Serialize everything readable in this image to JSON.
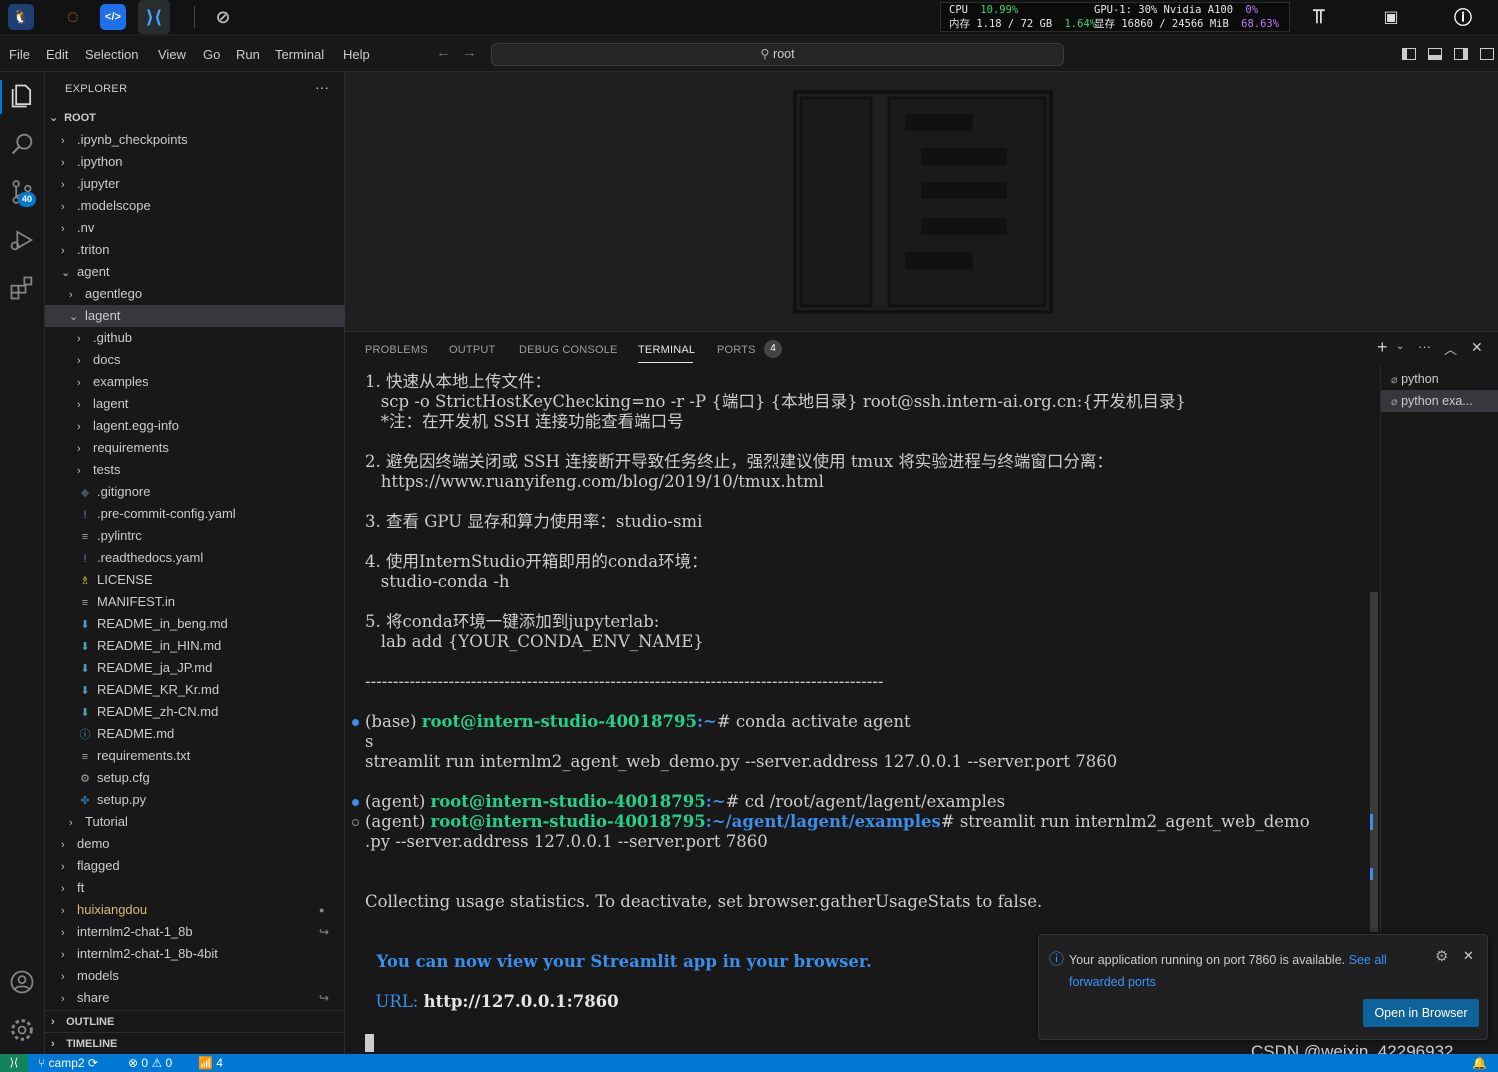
{
  "top_bar": {
    "stats": {
      "cpu_label": "CPU",
      "cpu_value": "10.99%",
      "gpu_label": "GPU-1: 30% Nvidia A100",
      "gpu_value": "0%",
      "mem_label": "内存 1.18 / 72 GB",
      "mem_value": "1.64%",
      "vram_label": "显存 16860 / 24566 MiB",
      "vram_value": "68.63%"
    }
  },
  "menu": {
    "items": [
      "File",
      "Edit",
      "Selection",
      "View",
      "Go",
      "Run",
      "Terminal",
      "Help"
    ],
    "search_text": "root"
  },
  "activity": {
    "scm_badge": "40"
  },
  "sidebar": {
    "title": "EXPLORER",
    "root_label": "ROOT",
    "tree": [
      {
        "label": ".ipynb_checkpoints",
        "depth": 1,
        "kind": "folder",
        "open": false
      },
      {
        "label": ".ipython",
        "depth": 1,
        "kind": "folder",
        "open": false
      },
      {
        "label": ".jupyter",
        "depth": 1,
        "kind": "folder",
        "open": false
      },
      {
        "label": ".modelscope",
        "depth": 1,
        "kind": "folder",
        "open": false
      },
      {
        "label": ".nv",
        "depth": 1,
        "kind": "folder",
        "open": false
      },
      {
        "label": ".triton",
        "depth": 1,
        "kind": "folder",
        "open": false
      },
      {
        "label": "agent",
        "depth": 1,
        "kind": "folder",
        "open": true
      },
      {
        "label": "agentlego",
        "depth": 2,
        "kind": "folder",
        "open": false
      },
      {
        "label": "lagent",
        "depth": 2,
        "kind": "folder",
        "open": true,
        "selected": true
      },
      {
        "label": ".github",
        "depth": 3,
        "kind": "folder",
        "open": false
      },
      {
        "label": "docs",
        "depth": 3,
        "kind": "folder",
        "open": false
      },
      {
        "label": "examples",
        "depth": 3,
        "kind": "folder",
        "open": false
      },
      {
        "label": "lagent",
        "depth": 3,
        "kind": "folder",
        "open": false
      },
      {
        "label": "lagent.egg-info",
        "depth": 3,
        "kind": "folder",
        "open": false
      },
      {
        "label": "requirements",
        "depth": 3,
        "kind": "folder",
        "open": false
      },
      {
        "label": "tests",
        "depth": 3,
        "kind": "folder",
        "open": false
      },
      {
        "label": ".gitignore",
        "depth": 3,
        "kind": "file",
        "icon": "◆",
        "icon_color": "#41535b"
      },
      {
        "label": ".pre-commit-config.yaml",
        "depth": 3,
        "kind": "file",
        "icon": "!",
        "icon_color": "#a074c4"
      },
      {
        "label": ".pylintrc",
        "depth": 3,
        "kind": "file",
        "icon": "≡",
        "icon_color": "#9da5b4"
      },
      {
        "label": ".readthedocs.yaml",
        "depth": 3,
        "kind": "file",
        "icon": "!",
        "icon_color": "#a074c4"
      },
      {
        "label": "LICENSE",
        "depth": 3,
        "kind": "file",
        "icon": "♗",
        "icon_color": "#cbcb41"
      },
      {
        "label": "MANIFEST.in",
        "depth": 3,
        "kind": "file",
        "icon": "≡",
        "icon_color": "#9da5b4"
      },
      {
        "label": "README_in_beng.md",
        "depth": 3,
        "kind": "file",
        "icon": "⬇",
        "icon_color": "#519aba"
      },
      {
        "label": "README_in_HIN.md",
        "depth": 3,
        "kind": "file",
        "icon": "⬇",
        "icon_color": "#519aba"
      },
      {
        "label": "README_ja_JP.md",
        "depth": 3,
        "kind": "file",
        "icon": "⬇",
        "icon_color": "#519aba"
      },
      {
        "label": "README_KR_Kr.md",
        "depth": 3,
        "kind": "file",
        "icon": "⬇",
        "icon_color": "#519aba"
      },
      {
        "label": "README_zh-CN.md",
        "depth": 3,
        "kind": "file",
        "icon": "⬇",
        "icon_color": "#519aba"
      },
      {
        "label": "README.md",
        "depth": 3,
        "kind": "file",
        "icon": "ⓘ",
        "icon_color": "#519aba"
      },
      {
        "label": "requirements.txt",
        "depth": 3,
        "kind": "file",
        "icon": "≡",
        "icon_color": "#9da5b4"
      },
      {
        "label": "setup.cfg",
        "depth": 3,
        "kind": "file",
        "icon": "⚙",
        "icon_color": "#9da5b4"
      },
      {
        "label": "setup.py",
        "depth": 3,
        "kind": "file",
        "icon": "✤",
        "icon_color": "#3572a5"
      },
      {
        "label": "Tutorial",
        "depth": 2,
        "kind": "folder",
        "open": false
      },
      {
        "label": "demo",
        "depth": 1,
        "kind": "folder",
        "open": false
      },
      {
        "label": "flagged",
        "depth": 1,
        "kind": "folder",
        "open": false
      },
      {
        "label": "ft",
        "depth": 1,
        "kind": "folder",
        "open": false
      },
      {
        "label": "huixiangdou",
        "depth": 1,
        "kind": "folder",
        "open": false,
        "color": "#d7ba7d",
        "deco": "●"
      },
      {
        "label": "internlm2-chat-1_8b",
        "depth": 1,
        "kind": "folder",
        "open": false,
        "deco": "↪"
      },
      {
        "label": "internlm2-chat-1_8b-4bit",
        "depth": 1,
        "kind": "folder",
        "open": false
      },
      {
        "label": "models",
        "depth": 1,
        "kind": "folder",
        "open": false
      },
      {
        "label": "share",
        "depth": 1,
        "kind": "folder",
        "open": false,
        "deco": "↪"
      }
    ],
    "outline_label": "OUTLINE",
    "timeline_label": "TIMELINE"
  },
  "panel": {
    "tabs": [
      "PROBLEMS",
      "OUTPUT",
      "DEBUG CONSOLE",
      "TERMINAL",
      "PORTS"
    ],
    "ports_badge": "4",
    "terminals": [
      "python",
      "python  exa..."
    ],
    "terminal": {
      "l1": "1. 快速从本地上传文件：",
      "l2": "   scp -o StrictHostKeyChecking=no -r -P {端口} {本地目录} root@ssh.intern-ai.org.cn:{开发机目录}",
      "l3": "   *注：在开发机 SSH 连接功能查看端口号",
      "l4": "2. 避免因终端关闭或 SSH 连接断开导致任务终止，强烈建议使用 tmux 将实验进程与终端窗口分离：",
      "l5": "   https://www.ruanyifeng.com/blog/2019/10/tmux.html",
      "l6": "3. 查看 GPU 显存和算力使用率：studio-smi",
      "l7": "4. 使用InternStudio开箱即用的conda环境：",
      "l8": "   studio-conda -h",
      "l9": "5. 将conda环境一键添加到jupyterlab:",
      "l10": "   lab add {YOUR_CONDA_ENV_NAME}",
      "sep": "---------------------------------------------------------------------------------------------",
      "p1_env": "(base) ",
      "p1_user": "root@intern-studio-40018795",
      "p1_path": ":~",
      "p1_cmd": "# conda activate agent",
      "s_line": "s",
      "run1": "streamlit run internlm2_agent_web_demo.py --server.address 127.0.0.1 --server.port 7860",
      "p2_env": "(agent) ",
      "p2_user": "root@intern-studio-40018795",
      "p2_path": ":~",
      "p2_cmd": "# cd /root/agent/lagent/examples",
      "p3_env": "(agent) ",
      "p3_user": "root@intern-studio-40018795",
      "p3_path": ":~/agent/lagent/examples",
      "p3_cmd": "# streamlit run internlm2_agent_web_demo",
      "p3_cont": ".py --server.address 127.0.0.1 --server.port 7860",
      "collect": "Collecting usage statistics. To deactivate, set browser.gatherUsageStats to false.",
      "view": "  You can now view your Streamlit app in your browser.",
      "url_label": "  URL: ",
      "url_value": "http://127.0.0.1:7860"
    }
  },
  "notification": {
    "message": "Your application running on port 7860 is available.",
    "link1": "See all",
    "link2": "forwarded ports",
    "button": "Open in Browser"
  },
  "status_bar": {
    "branch": "camp2",
    "errors": "0",
    "warnings": "0",
    "ports": "4"
  },
  "watermark": "CSDN @weixin_42296932"
}
